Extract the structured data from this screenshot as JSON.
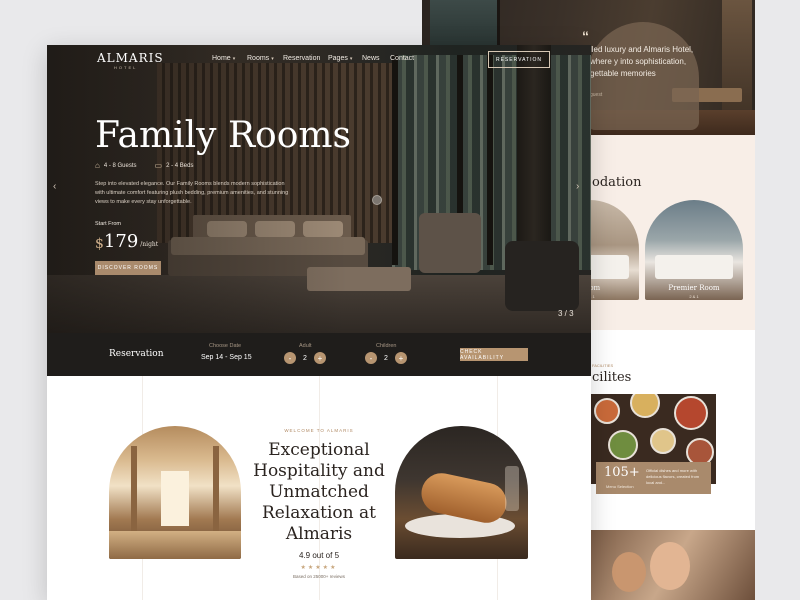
{
  "colors": {
    "accent": "#b79571",
    "dark_bar": "#1f1d1b",
    "cream": "#f8eee7",
    "text_dark": "#2b2420"
  },
  "header": {
    "logo": "ALMARIS",
    "logo_sub": "HOTEL",
    "nav": [
      {
        "label": "Home",
        "dropdown": true
      },
      {
        "label": "Rooms",
        "dropdown": true
      },
      {
        "label": "Reservation",
        "dropdown": false
      },
      {
        "label": "Pages",
        "dropdown": true
      },
      {
        "label": "News",
        "dropdown": false
      },
      {
        "label": "Contact",
        "dropdown": false
      }
    ],
    "cta": "RESERVATION"
  },
  "hero": {
    "title": "Family Rooms",
    "guests": "4 - 8 Guests",
    "beds": "2 - 4 Beds",
    "guests_icon": "sofa-icon",
    "beds_icon": "bed-icon",
    "description": "Step into elevated elegance. Our Family Rooms blends modern sophistication with ultimate comfort featuring plush bedding, premium amenities, and stunning views to make every stay unforgettable.",
    "start_from": "Start From",
    "currency": "$",
    "price": "179",
    "price_unit": "/night",
    "button": "DISCOVER ROOMS",
    "slide_counter": "3 / 3",
    "prev_icon": "chevron-left-icon",
    "next_icon": "chevron-right-icon"
  },
  "reservation": {
    "title": "Reservation",
    "date_label": "Choose Date",
    "date_value": "Sep 14 - Sep 15",
    "adult_label": "Adult",
    "adult_value": "2",
    "children_label": "Children",
    "children_value": "2",
    "minus": "-",
    "plus": "+",
    "check_button": "CHECK AVAILABILITY"
  },
  "welcome": {
    "overline": "WELCOME TO ALMARIS",
    "title": "Exceptional Hospitality and Unmatched Relaxation at Almaris",
    "rating": "4.9 out of 5",
    "stars": "★★★★★",
    "reviews": "Based on 25000+ reviews"
  },
  "back_page": {
    "quote_mark": "“",
    "quote_text": "lled luxury and Almaris Hotel, where y into sophistication, gettable memories",
    "quote_sub": "guest",
    "accommodation_title": "odation",
    "rooms": [
      {
        "name": "Room",
        "sub": "2 & 1"
      },
      {
        "name": "Premier Room",
        "sub": "2 & 1"
      }
    ],
    "facilities_overline": "FACILITIES",
    "facilities_title": "cilites",
    "stat_number": "105+",
    "stat_sub": "Menu Selection",
    "stat_desc": "Official dishes and more with delicious flavors, created from local and..."
  }
}
